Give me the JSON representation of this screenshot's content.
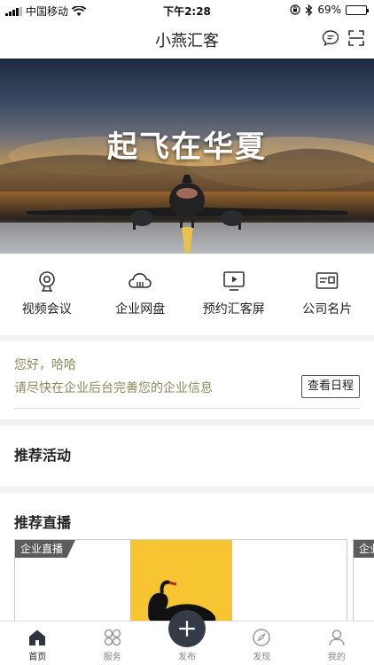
{
  "status_bar": {
    "carrier": "中国移动",
    "time": "下午2:28",
    "battery": "69%",
    "battery_level": 0.69
  },
  "header": {
    "title": "小燕汇客"
  },
  "banner": {
    "text": "起飞在华夏"
  },
  "quick_actions": [
    {
      "label": "视频会议",
      "icon": "webcam-icon"
    },
    {
      "label": "企业网盘",
      "icon": "cloud-icon"
    },
    {
      "label": "预约汇客屏",
      "icon": "screen-play-icon"
    },
    {
      "label": "公司名片",
      "icon": "business-card-icon"
    }
  ],
  "greeting": {
    "hello": "您好，哈哈",
    "message": "请尽快在企业后台完善您的企业信息",
    "schedule_button": "查看日程"
  },
  "sections": {
    "activities": "推荐活动",
    "live": "推荐直播"
  },
  "live_cards": [
    {
      "tag": "企业直播"
    },
    {
      "tag": "企业直播"
    }
  ],
  "tabs": [
    {
      "label": "首页",
      "icon": "home-icon",
      "active": true
    },
    {
      "label": "服务",
      "icon": "grid-icon",
      "active": false
    },
    {
      "label": "发布",
      "icon": "plus-icon",
      "active": false
    },
    {
      "label": "发现",
      "icon": "compass-icon",
      "active": false
    },
    {
      "label": "我的",
      "icon": "user-icon",
      "active": false
    }
  ],
  "colors": {
    "greeting_text": "#8c8a5c",
    "banner_sky_top": "#1e2a3d",
    "banner_horizon": "#c89a55",
    "live_thumb": "#f7c531",
    "publish_button": "#343a46"
  }
}
